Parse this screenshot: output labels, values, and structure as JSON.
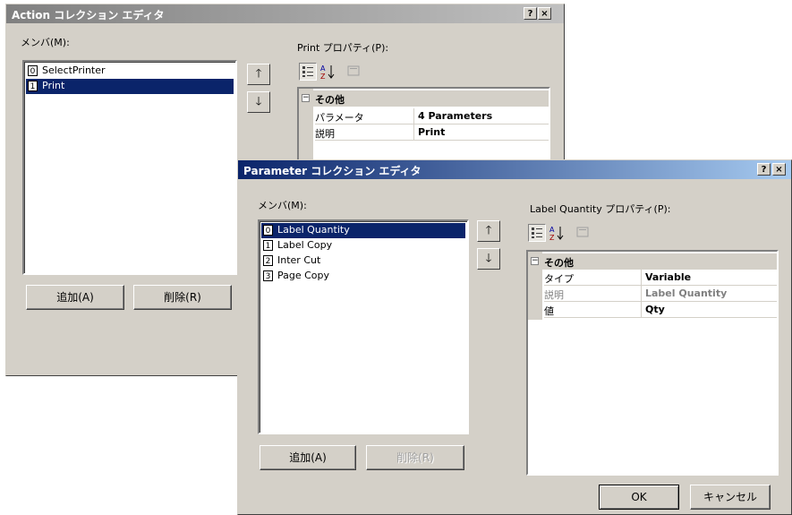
{
  "action_dialog": {
    "title": "Action コレクション エディタ",
    "help": "?",
    "close": "×",
    "members_label": "メンバ(M):",
    "members": [
      {
        "index": "0",
        "name": "SelectPrinter"
      },
      {
        "index": "1",
        "name": "Print"
      }
    ],
    "up_arrow": "🡑",
    "down_arrow": "🡓",
    "add_button": "追加(A)",
    "remove_button": "削除(R)",
    "properties_label": "Print プロパティ(P):",
    "category": "その他",
    "properties": [
      {
        "name": "パラメータ",
        "value": "4 Parameters"
      },
      {
        "name": "説明",
        "value": "Print"
      }
    ]
  },
  "parameter_dialog": {
    "title": "Parameter コレクション エディタ",
    "help": "?",
    "close": "×",
    "members_label": "メンバ(M):",
    "members": [
      {
        "index": "0",
        "name": "Label Quantity"
      },
      {
        "index": "1",
        "name": "Label Copy"
      },
      {
        "index": "2",
        "name": "Inter Cut"
      },
      {
        "index": "3",
        "name": "Page Copy"
      }
    ],
    "up_arrow": "🡑",
    "down_arrow": "🡓",
    "add_button": "追加(A)",
    "remove_button": "削除(R)",
    "properties_label": "Label Quantity プロパティ(P):",
    "category": "その他",
    "properties": [
      {
        "name": "タイプ",
        "value": "Variable"
      },
      {
        "name": "説明",
        "value": "Label Quantity"
      },
      {
        "name": "値",
        "value": "Qty"
      }
    ],
    "ok_button": "OK",
    "cancel_button": "キャンセル"
  },
  "colors": {
    "title_active": "#0a246a",
    "title_inactive": "#808080",
    "face": "#d4d0c8",
    "selection": "#0a246a"
  }
}
